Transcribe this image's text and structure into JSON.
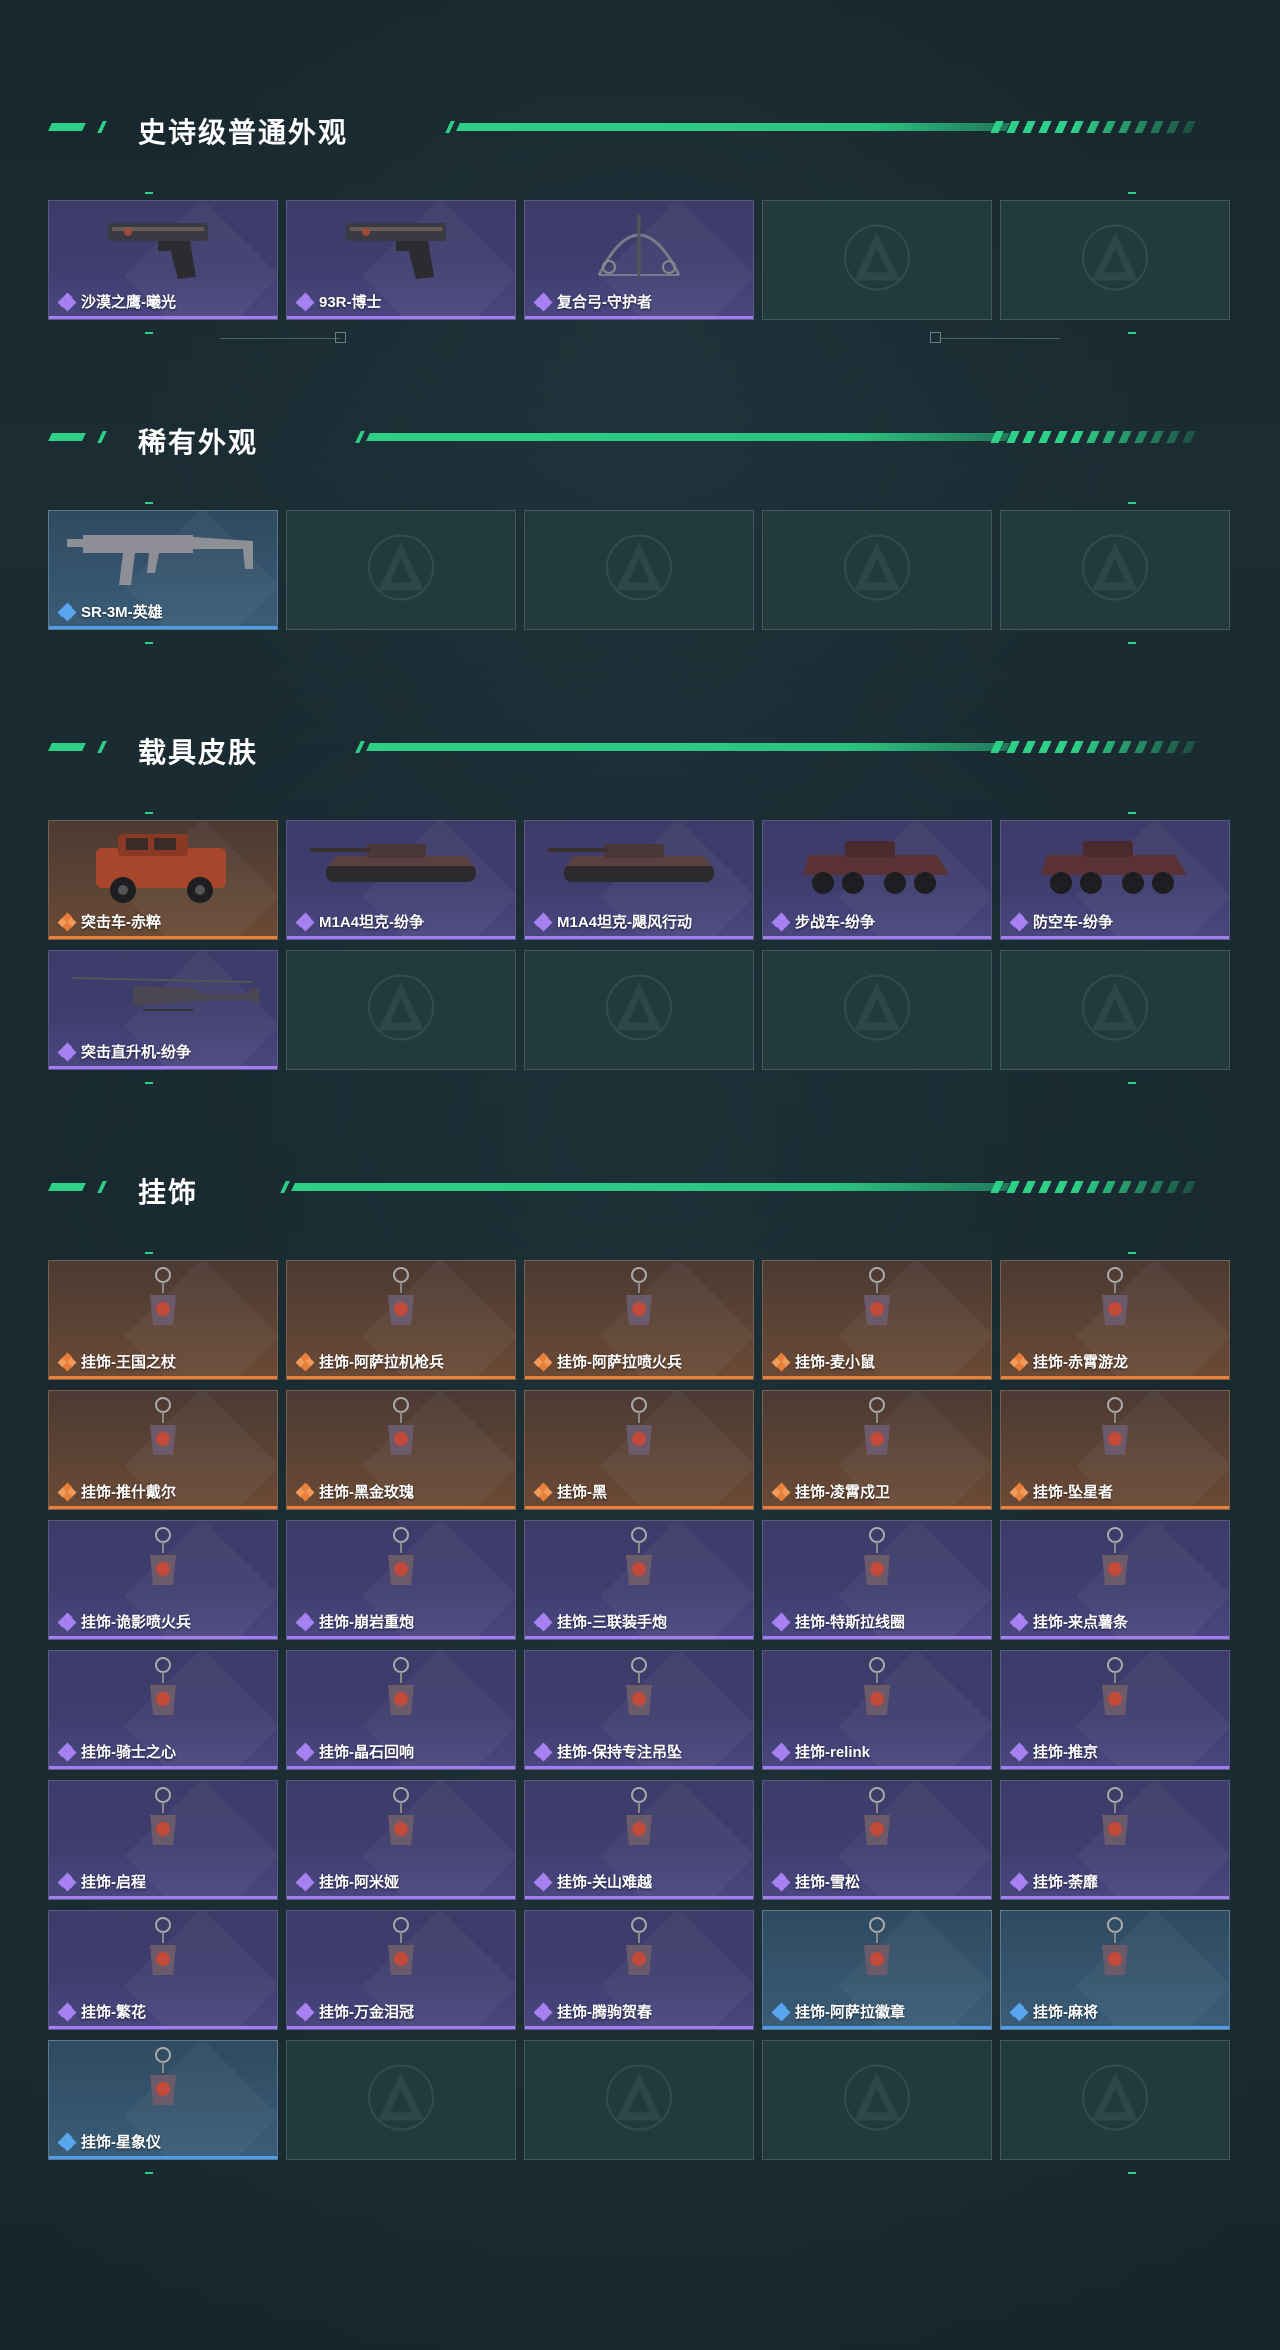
{
  "sections": [
    {
      "title": "史诗级普通外观",
      "items": [
        {
          "label": "沙漠之鹰-曦光",
          "rarity": "purple",
          "icon": "pistol-icon"
        },
        {
          "label": "93R-博士",
          "rarity": "purple",
          "icon": "pistol-icon"
        },
        {
          "label": "复合弓-守护者",
          "rarity": "purple",
          "icon": "bow-icon"
        },
        {
          "label": "",
          "rarity": "empty"
        },
        {
          "label": "",
          "rarity": "empty"
        }
      ]
    },
    {
      "title": "稀有外观",
      "items": [
        {
          "label": "SR-3M-英雄",
          "rarity": "blue",
          "icon": "rifle-icon"
        },
        {
          "label": "",
          "rarity": "empty"
        },
        {
          "label": "",
          "rarity": "empty"
        },
        {
          "label": "",
          "rarity": "empty"
        },
        {
          "label": "",
          "rarity": "empty"
        }
      ]
    },
    {
      "title": "载具皮肤",
      "items": [
        {
          "label": "突击车-赤粹",
          "rarity": "orange",
          "icon": "assault-vehicle-icon"
        },
        {
          "label": "M1A4坦克-纷争",
          "rarity": "purple",
          "icon": "tank-icon"
        },
        {
          "label": "M1A4坦克-飓风行动",
          "rarity": "purple",
          "icon": "tank-icon"
        },
        {
          "label": "步战车-纷争",
          "rarity": "purple",
          "icon": "ifv-icon"
        },
        {
          "label": "防空车-纷争",
          "rarity": "purple",
          "icon": "ifv-icon"
        },
        {
          "label": "突击直升机-纷争",
          "rarity": "purple",
          "icon": "helicopter-icon"
        },
        {
          "label": "",
          "rarity": "empty"
        },
        {
          "label": "",
          "rarity": "empty"
        },
        {
          "label": "",
          "rarity": "empty"
        },
        {
          "label": "",
          "rarity": "empty"
        }
      ]
    },
    {
      "title": "挂饰",
      "items": [
        {
          "label": "挂饰-王国之杖",
          "rarity": "orange",
          "icon": "charm-icon"
        },
        {
          "label": "挂饰-阿萨拉机枪兵",
          "rarity": "orange",
          "icon": "charm-icon"
        },
        {
          "label": "挂饰-阿萨拉喷火兵",
          "rarity": "orange",
          "icon": "charm-icon"
        },
        {
          "label": "挂饰-麦小鼠",
          "rarity": "orange",
          "icon": "charm-icon"
        },
        {
          "label": "挂饰-赤霄游龙",
          "rarity": "orange",
          "icon": "charm-icon"
        },
        {
          "label": "挂饰-推什戴尔",
          "rarity": "orange",
          "icon": "charm-icon"
        },
        {
          "label": "挂饰-黑金玫瑰",
          "rarity": "orange",
          "icon": "charm-icon"
        },
        {
          "label": "挂饰-黑",
          "rarity": "orange",
          "icon": "charm-icon"
        },
        {
          "label": "挂饰-凌霄戍卫",
          "rarity": "orange",
          "icon": "charm-icon"
        },
        {
          "label": "挂饰-坠星者",
          "rarity": "orange",
          "icon": "charm-icon"
        },
        {
          "label": "挂饰-诡影喷火兵",
          "rarity": "purple",
          "icon": "charm-icon"
        },
        {
          "label": "挂饰-崩岩重炮",
          "rarity": "purple",
          "icon": "charm-icon"
        },
        {
          "label": "挂饰-三联装手炮",
          "rarity": "purple",
          "icon": "charm-icon"
        },
        {
          "label": "挂饰-特斯拉线圈",
          "rarity": "purple",
          "icon": "charm-icon"
        },
        {
          "label": "挂饰-来点薯条",
          "rarity": "purple",
          "icon": "charm-icon"
        },
        {
          "label": "挂饰-骑士之心",
          "rarity": "purple",
          "icon": "charm-icon"
        },
        {
          "label": "挂饰-晶石回响",
          "rarity": "purple",
          "icon": "charm-icon"
        },
        {
          "label": "挂饰-保持专注吊坠",
          "rarity": "purple",
          "icon": "charm-icon"
        },
        {
          "label": "挂饰-relink",
          "rarity": "purple",
          "icon": "charm-icon"
        },
        {
          "label": "挂饰-推京",
          "rarity": "purple",
          "icon": "charm-icon"
        },
        {
          "label": "挂饰-启程",
          "rarity": "purple",
          "icon": "charm-icon"
        },
        {
          "label": "挂饰-阿米娅",
          "rarity": "purple",
          "icon": "charm-icon"
        },
        {
          "label": "挂饰-关山难越",
          "rarity": "purple",
          "icon": "charm-icon"
        },
        {
          "label": "挂饰-雪松",
          "rarity": "purple",
          "icon": "charm-icon"
        },
        {
          "label": "挂饰-荼靡",
          "rarity": "purple",
          "icon": "charm-icon"
        },
        {
          "label": "挂饰-繁花",
          "rarity": "purple",
          "icon": "charm-icon"
        },
        {
          "label": "挂饰-万金泪冠",
          "rarity": "purple",
          "icon": "charm-icon"
        },
        {
          "label": "挂饰-腾驹贺春",
          "rarity": "purple",
          "icon": "charm-icon"
        },
        {
          "label": "挂饰-阿萨拉徽章",
          "rarity": "blue",
          "icon": "charm-icon"
        },
        {
          "label": "挂饰-麻将",
          "rarity": "blue",
          "icon": "charm-icon"
        },
        {
          "label": "挂饰-星象仪",
          "rarity": "blue",
          "icon": "charm-icon"
        },
        {
          "label": "",
          "rarity": "empty"
        },
        {
          "label": "",
          "rarity": "empty"
        },
        {
          "label": "",
          "rarity": "empty"
        },
        {
          "label": "",
          "rarity": "empty"
        }
      ]
    }
  ],
  "colors": {
    "accent": "#2ecf86",
    "rarity_purple": "#a27df0",
    "rarity_orange": "#e8803c",
    "rarity_blue": "#4e9de6",
    "empty_slot": "#223a3e"
  }
}
